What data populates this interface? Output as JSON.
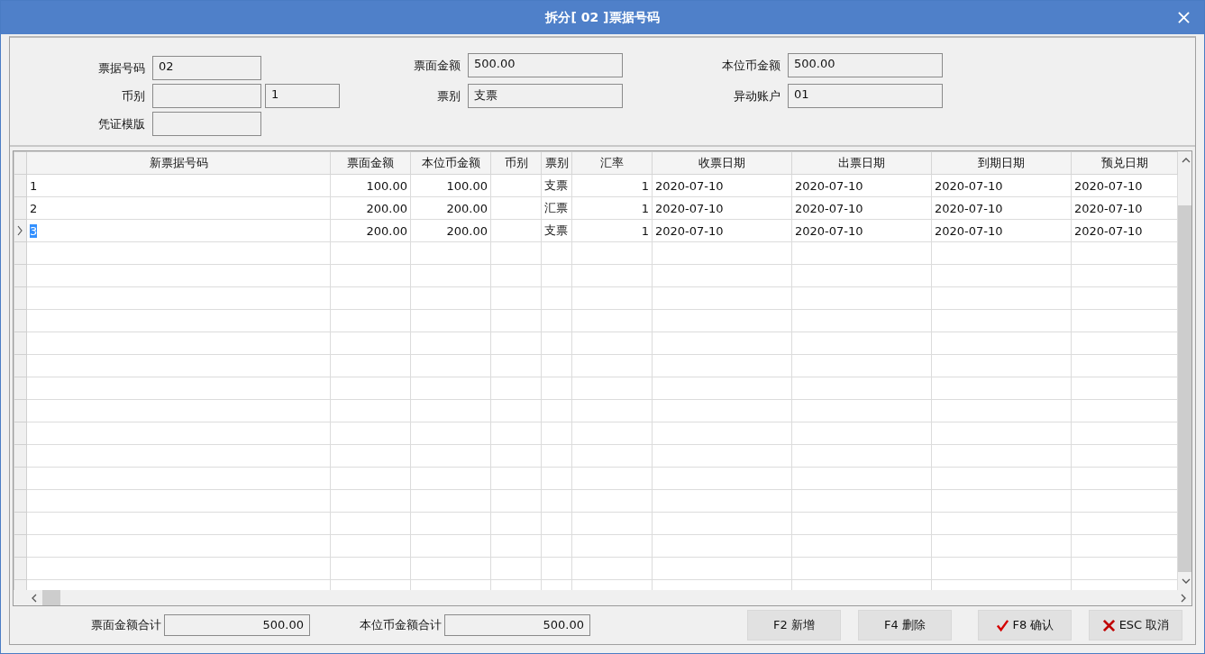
{
  "window": {
    "title": "拆分[ 02 ]票据号码"
  },
  "form": {
    "columns": [
      [
        {
          "label": "票据号码",
          "value": "02"
        },
        {
          "label": "币别",
          "extra": "1"
        },
        {
          "label": "凭证模版"
        }
      ],
      [
        {
          "label": "票面金额",
          "value": "500.00"
        },
        {
          "label": "票别",
          "value": "支票"
        }
      ],
      [
        {
          "label": "本位币金额",
          "value": "500.00"
        },
        {
          "label": "异动账户",
          "value": "01"
        }
      ]
    ]
  },
  "table": {
    "columns": [
      {
        "label": "新票据号码",
        "kind": "text"
      },
      {
        "label": "票面金额",
        "kind": "number"
      },
      {
        "label": "本位币金额",
        "kind": "number"
      },
      {
        "label": "币别",
        "kind": "text"
      },
      {
        "label": "票别",
        "kind": "text"
      },
      {
        "label": "汇率",
        "kind": "number"
      },
      {
        "label": "收票日期",
        "kind": "text"
      },
      {
        "label": "出票日期",
        "kind": "text"
      },
      {
        "label": "到期日期",
        "kind": "text"
      },
      {
        "label": "预兑日期",
        "kind": "text"
      }
    ],
    "rows": [
      {
        "selected": false,
        "cells": [
          "1",
          "100.00",
          "100.00",
          null,
          "支票",
          "1",
          "2020-07-10",
          "2020-07-10",
          "2020-07-10",
          "2020-07-10"
        ]
      },
      {
        "selected": false,
        "cells": [
          "2",
          "200.00",
          "200.00",
          null,
          "汇票",
          "1",
          "2020-07-10",
          "2020-07-10",
          "2020-07-10",
          "2020-07-10"
        ]
      },
      {
        "selected": true,
        "cells": [
          "3",
          "200.00",
          "200.00",
          null,
          "支票",
          "1",
          "2020-07-10",
          "2020-07-10",
          "2020-07-10",
          "2020-07-10"
        ]
      }
    ]
  },
  "totals": [
    {
      "label": "票面金额合计",
      "value": "500.00"
    },
    {
      "label": "本位币金额合计",
      "value": "500.00"
    }
  ],
  "buttons": [
    {
      "label": "F2 新增",
      "kind": "plain"
    },
    {
      "label": "F4 删除",
      "kind": "plain"
    },
    {
      "label": "F8 确认",
      "kind": "confirm"
    },
    {
      "label": "ESC 取消",
      "kind": "cancel"
    }
  ]
}
